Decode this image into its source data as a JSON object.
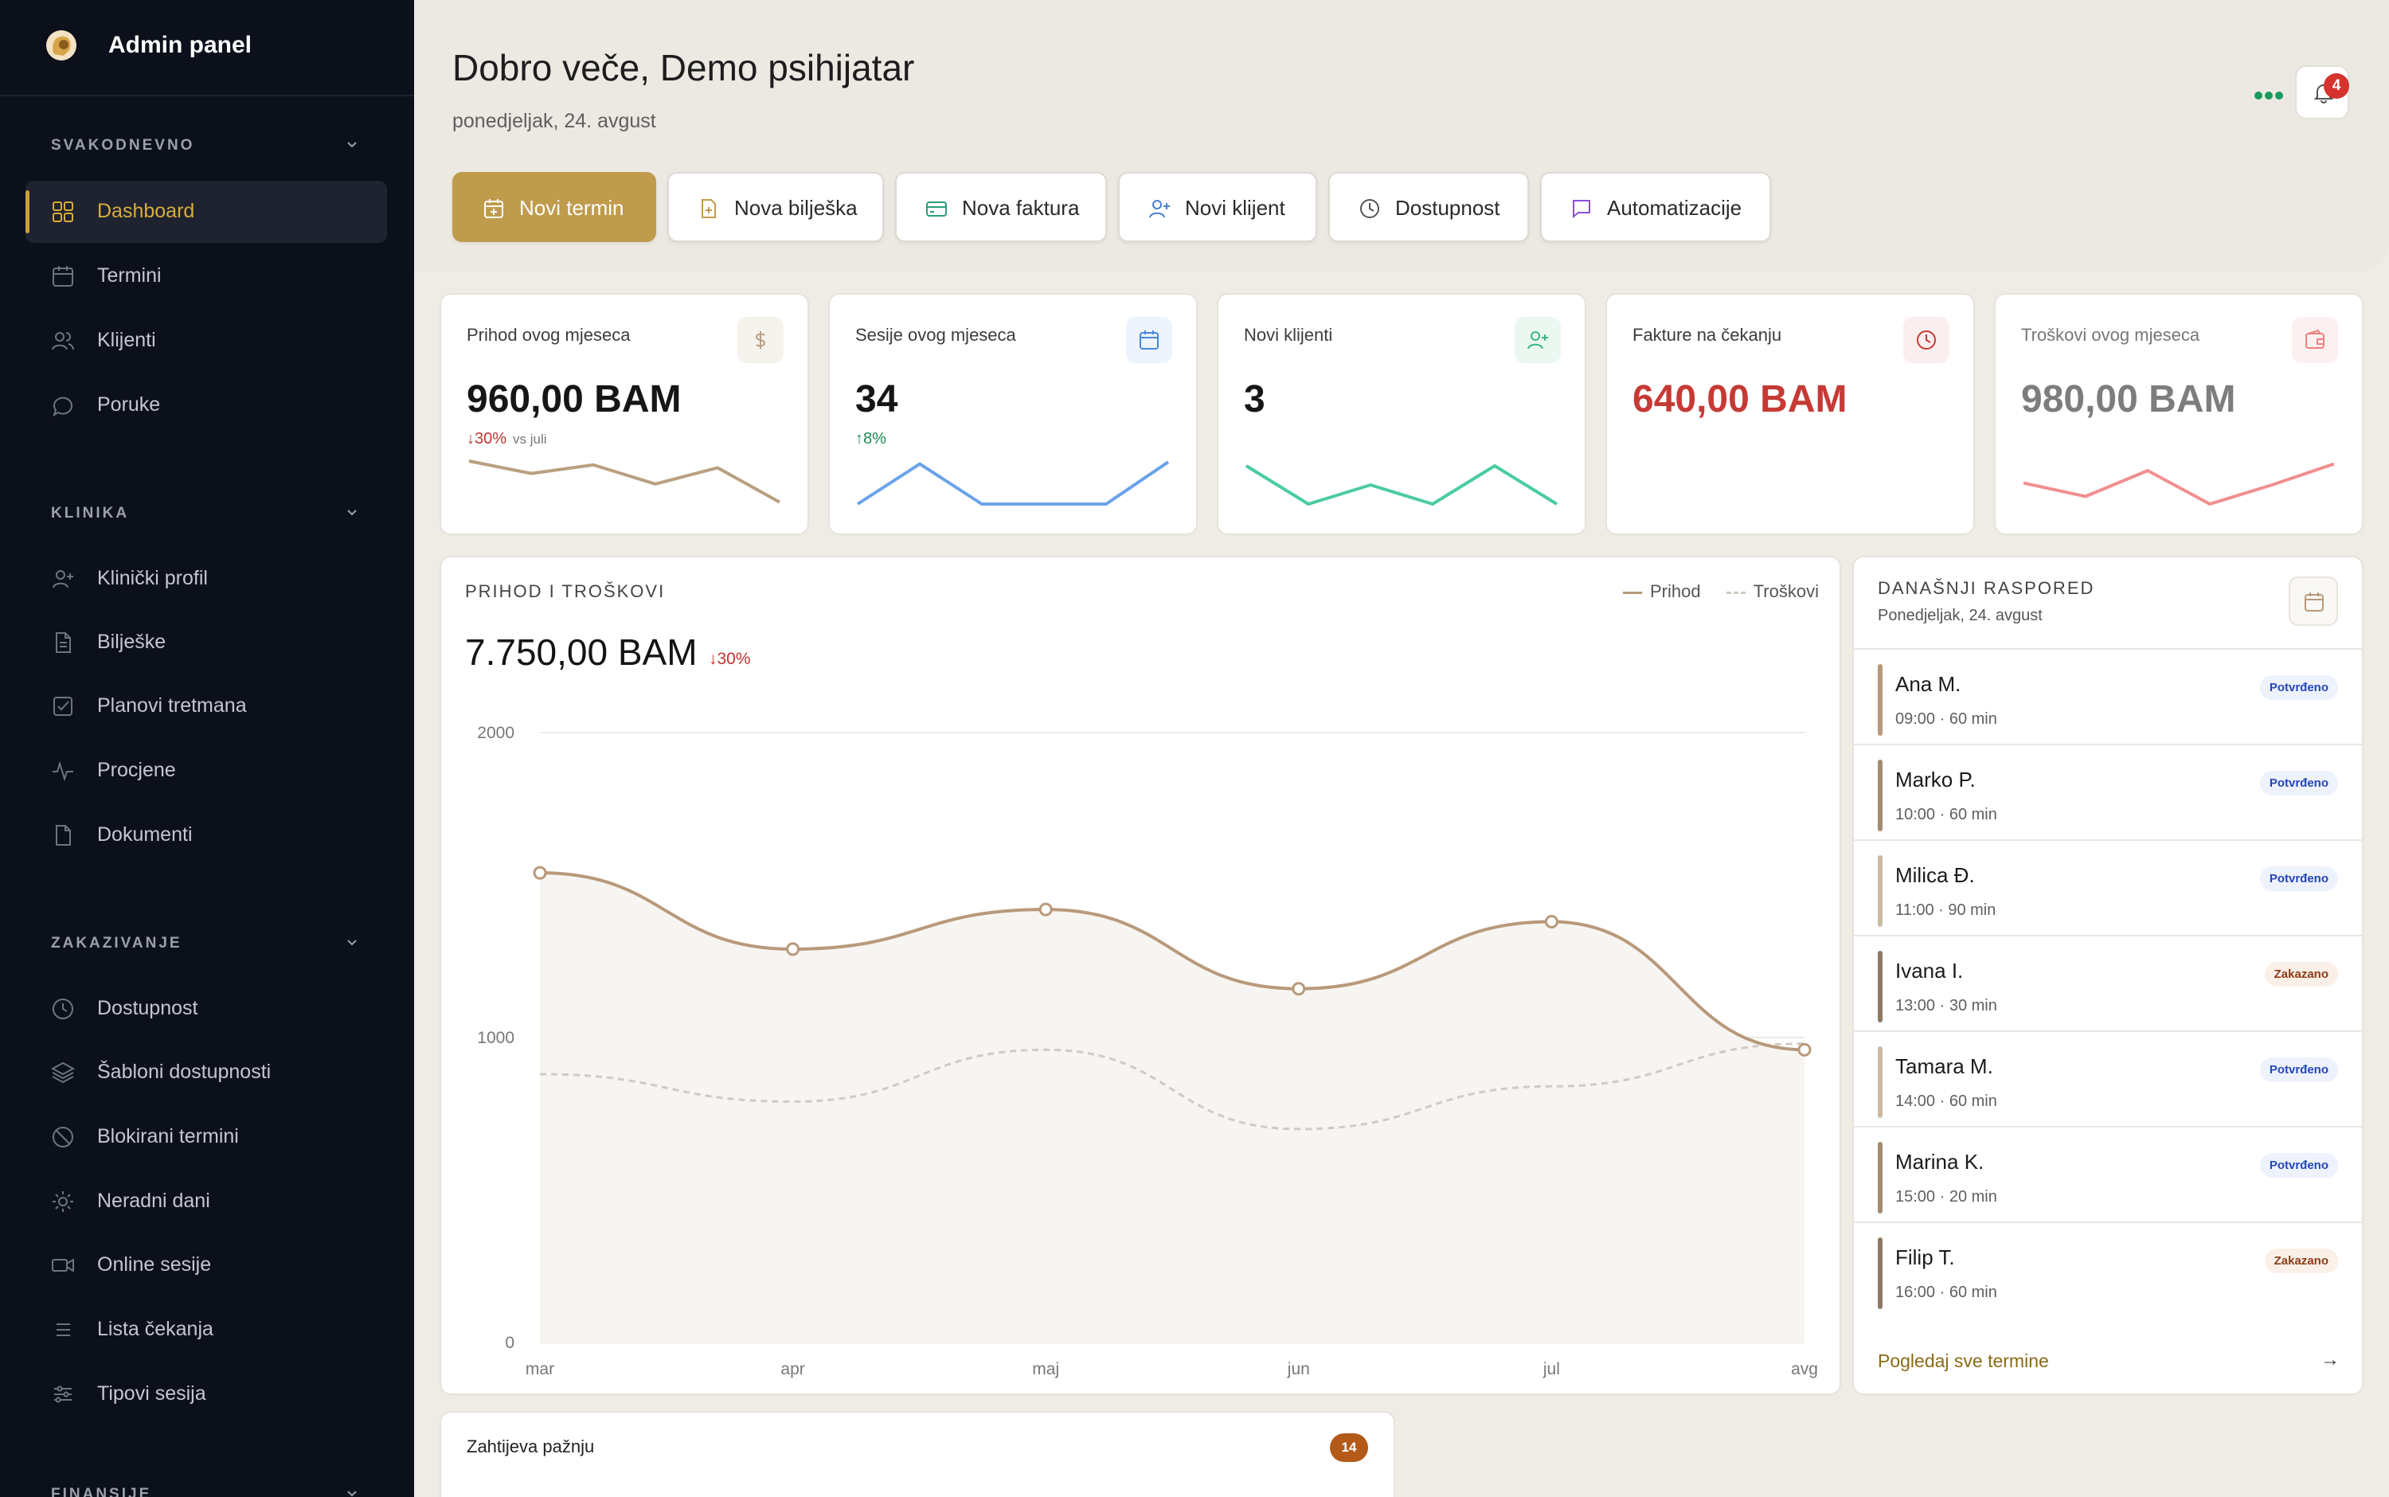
{
  "sidebar": {
    "brand": "Admin panel",
    "sections": [
      {
        "title": "SVAKODNEVNO",
        "items": [
          "Dashboard",
          "Termini",
          "Klijenti",
          "Poruke"
        ]
      },
      {
        "title": "KLINIKA",
        "items": [
          "Klinički profil",
          "Bilješke",
          "Planovi tretmana",
          "Procjene",
          "Dokumenti"
        ]
      },
      {
        "title": "ZAKAZIVANJE",
        "items": [
          "Dostupnost",
          "Šabloni dostupnosti",
          "Blokirani termini",
          "Neradni dani",
          "Online sesije",
          "Lista čekanja",
          "Tipovi sesija"
        ]
      },
      {
        "title": "FINANSIJE",
        "items": []
      }
    ],
    "active_item": "Dashboard",
    "accent": "#d9ad3a"
  },
  "header": {
    "title": "Dobro veče, Demo psihijatar",
    "date": "ponedjeljak, 24. avgust",
    "notification_count": "4",
    "actions": [
      "Novi termin",
      "Nova bilješka",
      "Nova faktura",
      "Novi klijent",
      "Dostupnost",
      "Automatizacije"
    ]
  },
  "stats": [
    {
      "label": "Prihod ovog mjeseca",
      "value": "960,00 BAM",
      "change": "↓30%",
      "change_sub": "vs juli",
      "icon": "dollar-icon",
      "color": "#b9a080",
      "spark": [
        5.5,
        4.2,
        5.1,
        3.1,
        4.8,
        1.2
      ]
    },
    {
      "label": "Sesije ovog mjeseca",
      "value": "34",
      "change": "↑8%",
      "change_sub": "",
      "icon": "calendar-icon",
      "color": "#6ba3e8",
      "spark": [
        1,
        5.2,
        1,
        1,
        1,
        5.4
      ]
    },
    {
      "label": "Novi klijenti",
      "value": "3",
      "change": "",
      "change_sub": "",
      "icon": "user-plus-icon",
      "color": "#4bcc9e",
      "spark": [
        5,
        1,
        3,
        1,
        5,
        1
      ]
    },
    {
      "label": "Fakture na čekanju",
      "value": "640,00 BAM",
      "change": "",
      "change_sub": "",
      "icon": "clock-icon",
      "color": "#c63a35",
      "spark": []
    },
    {
      "label": "Troškovi ovog mjeseca",
      "value": "980,00 BAM",
      "change": "",
      "change_sub": "",
      "icon": "wallet-icon",
      "color": "#f08f8f",
      "spark": [
        3.2,
        1.8,
        4.5,
        1,
        3,
        5.2
      ]
    }
  ],
  "revenue": {
    "title": "PRIHOD I TROŠKOVI",
    "total": "7.750,00 BAM",
    "change": "↓30%",
    "legend": [
      "Prihod",
      "Troškovi"
    ]
  },
  "chart_data": {
    "type": "line",
    "title": "PRIHOD I TROŠKOVI",
    "x": [
      "mar",
      "apr",
      "maj",
      "jun",
      "jul",
      "avg"
    ],
    "yticks": [
      "0",
      "1000",
      "2000"
    ],
    "ylim": [
      0,
      2000
    ],
    "series": [
      {
        "name": "Prihod",
        "values": [
          1540,
          1290,
          1420,
          1160,
          1380,
          960
        ],
        "color": "#b8997a",
        "style": "solid"
      },
      {
        "name": "Troškovi",
        "values": [
          880,
          790,
          960,
          700,
          840,
          980
        ],
        "color": "#cfcac3",
        "style": "dashed"
      }
    ],
    "grid": true,
    "legend": "top-right"
  },
  "schedule": {
    "title": "DANAŠNJI RASPORED",
    "date": "Ponedjeljak, 24. avgust",
    "items": [
      {
        "name": "Ana M.",
        "time": "09:00 · 60 min",
        "status": "Potvrđeno",
        "kind": "ok",
        "bar": "#b8997a"
      },
      {
        "name": "Marko P.",
        "time": "10:00 · 60 min",
        "status": "Potvrđeno",
        "kind": "ok",
        "bar": "#a38b72"
      },
      {
        "name": "Milica Đ.",
        "time": "11:00 · 90 min",
        "status": "Potvrđeno",
        "kind": "ok",
        "bar": "#cbbaa4"
      },
      {
        "name": "Ivana I.",
        "time": "13:00 · 30 min",
        "status": "Zakazano",
        "kind": "sch",
        "bar": "#8d7a66"
      },
      {
        "name": "Tamara M.",
        "time": "14:00 · 60 min",
        "status": "Potvrđeno",
        "kind": "ok",
        "bar": "#cbbaa4"
      },
      {
        "name": "Marina K.",
        "time": "15:00 · 20 min",
        "status": "Potvrđeno",
        "kind": "ok",
        "bar": "#a38b72"
      },
      {
        "name": "Filip T.",
        "time": "16:00 · 60 min",
        "status": "Zakazano",
        "kind": "sch",
        "bar": "#8d7a66"
      }
    ],
    "view_all": "Pogledaj sve termine",
    "arrow": "→"
  },
  "attention": {
    "title": "Zahtijeva pažnju",
    "count": "14"
  }
}
